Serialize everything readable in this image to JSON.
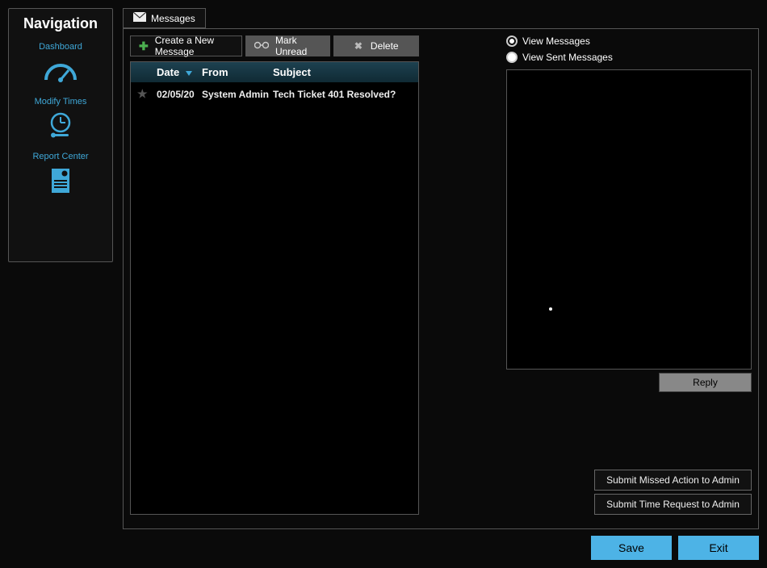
{
  "sidebar": {
    "title": "Navigation",
    "items": [
      {
        "label": "Dashboard"
      },
      {
        "label": "Modify Times"
      },
      {
        "label": "Report Center"
      }
    ]
  },
  "tabs": {
    "messages": "Messages"
  },
  "toolbar": {
    "new": "Create a New Message",
    "unread": "Mark Unread",
    "delete": "Delete"
  },
  "list": {
    "headers": {
      "date": "Date",
      "from": "From",
      "subject": "Subject"
    },
    "rows": [
      {
        "date": "02/05/20",
        "from": "System Admin",
        "subject": "Tech Ticket 401 Resolved?"
      }
    ]
  },
  "radios": {
    "view": "View Messages",
    "sent": "View Sent Messages"
  },
  "buttons": {
    "reply": "Reply",
    "missed": "Submit Missed Action to Admin",
    "timereq": "Submit Time Request to Admin",
    "save": "Save",
    "exit": "Exit"
  }
}
